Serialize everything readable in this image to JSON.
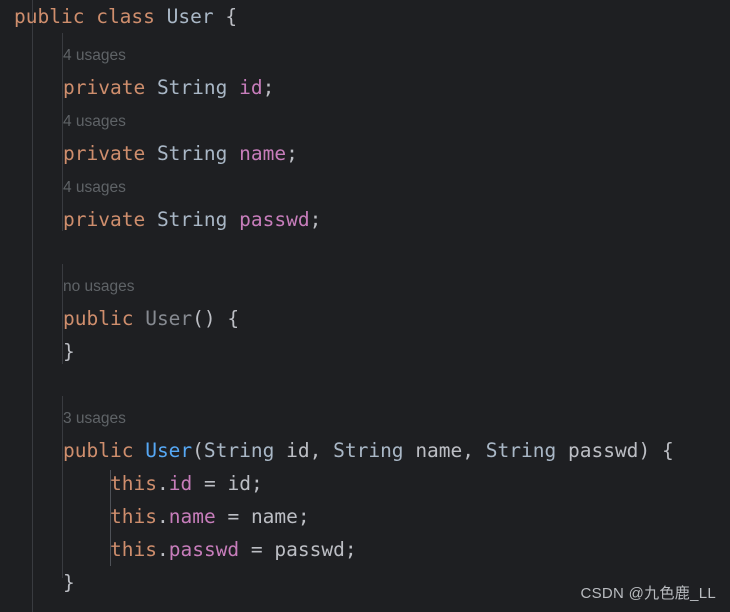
{
  "editor": {
    "background_color": "#1e1f22",
    "gutter_color": "#393b40",
    "language": "java",
    "theme": "dark"
  },
  "colors": {
    "keyword": "#cf8e6d",
    "type": "#a9b7c6",
    "class_name": "#a9b7c6",
    "class_name_unused": "#868a91",
    "constructor_used": "#56a8f5",
    "field": "#c77dbb",
    "plain_text": "#bcbec4",
    "usage_hint": "#5f6367",
    "watermark": "#b9bcc0"
  },
  "code": {
    "line_1": {
      "kw_public": "public",
      "kw_class": "class",
      "name": "User",
      "brace": "{"
    },
    "hint_1": "4 usages",
    "line_2": {
      "kw_private": "private",
      "type": "String",
      "field": "id",
      "semicolon": ";"
    },
    "hint_2": "4 usages",
    "line_3": {
      "kw_private": "private",
      "type": "String",
      "field": "name",
      "semicolon": ";"
    },
    "hint_3": "4 usages",
    "line_4": {
      "kw_private": "private",
      "type": "String",
      "field": "passwd",
      "semicolon": ";"
    },
    "hint_4": "no usages",
    "line_5": {
      "kw_public": "public",
      "name": "User",
      "parens": "()",
      "brace": "{"
    },
    "line_6": {
      "brace": "}"
    },
    "hint_5": "3 usages",
    "line_7": {
      "kw_public": "public",
      "name": "User",
      "open_paren": "(",
      "type_1": "String",
      "param_1": "id",
      "comma_1": ",",
      "type_2": "String",
      "param_2": "name",
      "comma_2": ",",
      "type_3": "String",
      "param_3": "passwd",
      "close_paren": ")",
      "brace": "{"
    },
    "line_8": {
      "kw_this": "this",
      "dot": ".",
      "field": "id",
      "equals": "=",
      "value": "id",
      "semicolon": ";"
    },
    "line_9": {
      "kw_this": "this",
      "dot": ".",
      "field": "name",
      "equals": "=",
      "value": "name",
      "semicolon": ";"
    },
    "line_10": {
      "kw_this": "this",
      "dot": ".",
      "field": "passwd",
      "equals": "=",
      "value": "passwd",
      "semicolon": ";"
    },
    "line_11": {
      "brace": "}"
    }
  },
  "watermark": {
    "text": "CSDN @九色鹿_LL"
  }
}
